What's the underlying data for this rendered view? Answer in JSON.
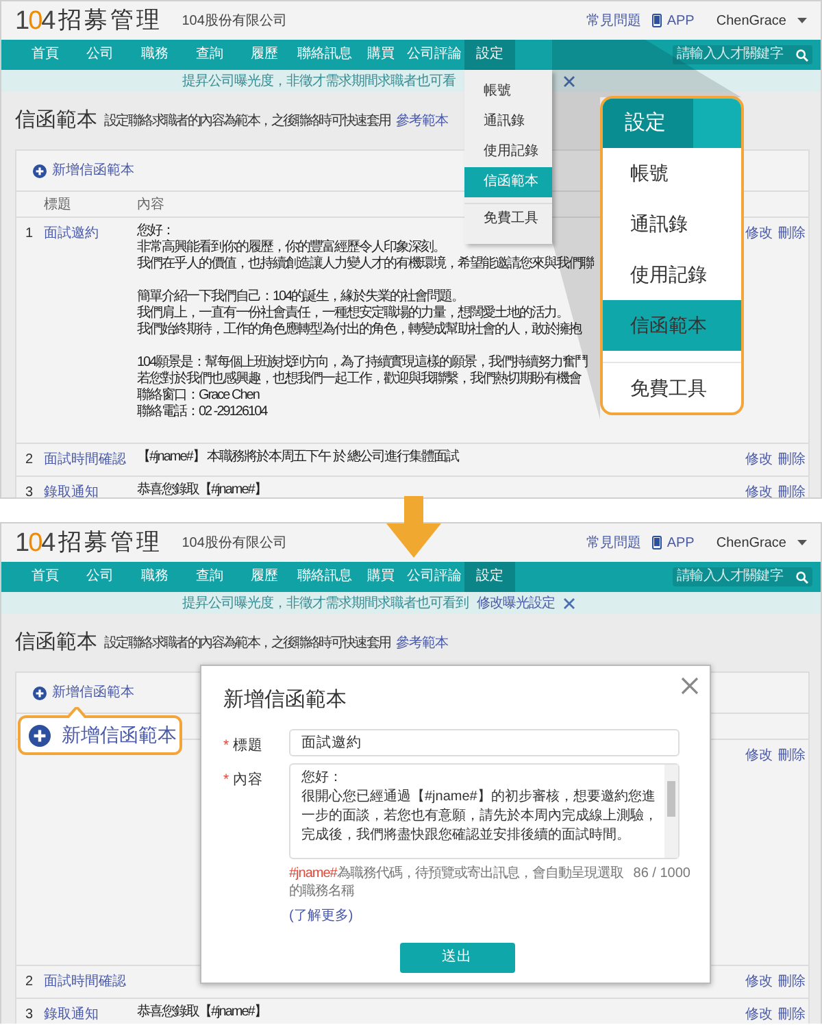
{
  "panels": [
    {
      "header": {
        "logo": "104",
        "product": "招募管理",
        "company": "104股份有限公司",
        "help": "常見問題",
        "app": "APP",
        "user": "ChenGrace"
      },
      "nav": [
        {
          "label": "首頁",
          "selected": false
        },
        {
          "label": "公司",
          "selected": false
        },
        {
          "label": "職務",
          "selected": false
        },
        {
          "label": "查詢",
          "selected": false
        },
        {
          "label": "履歷",
          "selected": false
        },
        {
          "label": "聯絡訊息",
          "selected": false
        },
        {
          "label": "購買",
          "selected": false
        },
        {
          "label": "公司評論",
          "selected": false
        },
        {
          "label": "設定",
          "selected": true
        }
      ],
      "search": {
        "placeholder": "請輸入人才關鍵字"
      },
      "banner": {
        "text": "提昇公司曝光度，非徵才需求期間求職者也可看"
      },
      "page": {
        "title": "信函範本",
        "description": "設定聯絡求職者的內容為範本，之後聯絡時可快速套用",
        "link": "參考範本"
      },
      "add_link": "新增信函範本",
      "table": {
        "columns": [
          "標題",
          "內容"
        ],
        "rows": [
          {
            "number": "1",
            "title": "面試邀約",
            "paragraphs": [
              [
                "您好：",
                "非常高興能看到你的履歷，你的豐富經歷令人印象深刻。",
                "我們在乎人的價值，也持續創造讓人力變人才的有機環境，希望能邀請您來與我們聯"
              ],
              [
                "簡單介紹一下我們自己：104的誕生，緣於失業的社會問題。",
                "我們肩上，一直有一份社會責任，一種想安定職場的力量，想闊愛土地的活力。",
                "我們始終期待，工作的角色應轉型為付出的角色，轉變成幫助社會的人，敢於擁抱"
              ],
              [
                "104願景是：幫每個上班族找到方向，為了持續實現這樣的願景，我們持續努力奮鬥",
                "若您對於我們也感興趣，也想我們一起工作，歡迎與我聯繫，我們熱切期盼有機會",
                "聯絡窗口：Grace Chen",
                "聯絡電話：02 -29126104"
              ]
            ],
            "actions": [
              "修改",
              "刪除"
            ]
          },
          {
            "number": "2",
            "title": "面試時間確認",
            "paragraphs": [
              [
                "【#jname#】 本職務將於本周五下午 於 總公司進行集體面試"
              ]
            ],
            "actions": [
              "修改",
              "刪除"
            ]
          },
          {
            "number": "3",
            "title": "錄取通知",
            "paragraphs": [
              [
                "恭喜您錄取【#jname#】"
              ]
            ],
            "actions": [
              "修改",
              "刪除"
            ]
          }
        ]
      },
      "dropdown": {
        "items": [
          {
            "label": "帳號",
            "selected": false,
            "separated": false
          },
          {
            "label": "通訊錄",
            "selected": false,
            "separated": false
          },
          {
            "label": "使用記錄",
            "selected": false,
            "separated": false
          },
          {
            "label": "信函範本",
            "selected": true,
            "separated": false
          },
          {
            "label": "免費工具",
            "selected": false,
            "separated": true
          }
        ]
      },
      "callout": {
        "title": "設定",
        "items": [
          {
            "label": "帳號",
            "selected": false,
            "separated": false
          },
          {
            "label": "通訊錄",
            "selected": false,
            "separated": false
          },
          {
            "label": "使用記錄",
            "selected": false,
            "separated": false
          },
          {
            "label": "信函範本",
            "selected": true,
            "separated": false
          },
          {
            "label": "免費工具",
            "selected": false,
            "separated": true
          }
        ]
      }
    },
    {
      "header": {
        "logo": "104",
        "product": "招募管理",
        "company": "104股份有限公司",
        "help": "常見問題",
        "app": "APP",
        "user": "ChenGrace"
      },
      "nav": [
        {
          "label": "首頁",
          "selected": false
        },
        {
          "label": "公司",
          "selected": false
        },
        {
          "label": "職務",
          "selected": false
        },
        {
          "label": "查詢",
          "selected": false
        },
        {
          "label": "履歷",
          "selected": false
        },
        {
          "label": "聯絡訊息",
          "selected": false
        },
        {
          "label": "購買",
          "selected": false
        },
        {
          "label": "公司評論",
          "selected": false
        },
        {
          "label": "設定",
          "selected": true
        }
      ],
      "search": {
        "placeholder": "請輸入人才關鍵字"
      },
      "banner": {
        "text": "提昇公司曝光度，非徵才需求期間求職者也可看到",
        "link": "修改曝光設定"
      },
      "page": {
        "title": "信函範本",
        "description": "設定聯絡求職者的內容為範本，之後聯絡時可快速套用",
        "link": "參考範本"
      },
      "add_link": "新增信函範本",
      "table": {
        "rows": [
          {
            "actions": [
              "修改",
              "刪除"
            ]
          },
          {
            "number": "2",
            "title": "面試時間確認",
            "actions": [
              "修改",
              "刪除"
            ]
          },
          {
            "number": "3",
            "title": "錄取通知",
            "paragraphs": [
              [
                "恭喜您錄取【#jname#】"
              ]
            ],
            "actions": [
              "修改",
              "刪除"
            ]
          }
        ]
      },
      "bubble": {
        "label": "新增信函範本"
      },
      "modal": {
        "title": "新增信函範本",
        "fields": [
          {
            "kind": "input",
            "mark": "*",
            "label": "標題",
            "value": "面試邀約"
          },
          {
            "kind": "textarea",
            "mark": "*",
            "label": "內容",
            "lines": [
              "您好：",
              "很開心您已經通過【#jname#】的初步審核，想要邀約您進一步的面談，若您也有意願，請先於本周內完成線上測驗，完成後，我們將盡快跟您確認並安排後續的面試時間。"
            ]
          }
        ],
        "hint": {
          "code": "#jname#",
          "text": "為職務代碼，待預覽或寄出訊息，會自動呈現選取的職務名稱"
        },
        "counter": "86 / 1000",
        "more_link": "(了解更多)",
        "submit": "送出"
      }
    }
  ]
}
